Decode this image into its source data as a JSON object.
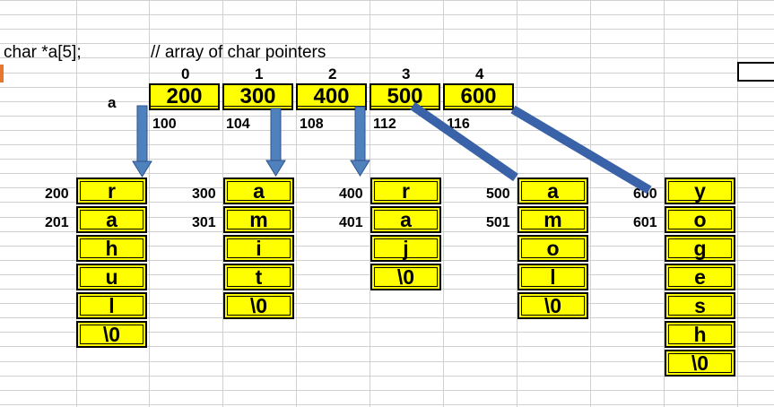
{
  "header": {
    "declaration": "char *a[5];",
    "comment": "// array of char pointers"
  },
  "array": {
    "name": "a",
    "indices": [
      "0",
      "1",
      "2",
      "3",
      "4"
    ],
    "values": [
      "200",
      "300",
      "400",
      "500",
      "600"
    ],
    "addresses": [
      "100",
      "104",
      "108",
      "112",
      "116"
    ]
  },
  "strings": [
    {
      "addresses": [
        "200",
        "201"
      ],
      "chars": [
        "r",
        "a",
        "h",
        "u",
        "l",
        "\\0"
      ]
    },
    {
      "addresses": [
        "300",
        "301"
      ],
      "chars": [
        "a",
        "m",
        "i",
        "t",
        "\\0"
      ]
    },
    {
      "addresses": [
        "400",
        "401"
      ],
      "chars": [
        "r",
        "a",
        "j",
        "\\0"
      ]
    },
    {
      "addresses": [
        "500",
        "501"
      ],
      "chars": [
        "a",
        "m",
        "o",
        "l",
        "\\0"
      ]
    },
    {
      "addresses": [
        "600",
        "601"
      ],
      "chars": [
        "y",
        "o",
        "g",
        "e",
        "s",
        "h",
        "\\0"
      ]
    }
  ],
  "colors": {
    "cell_fill": "#ffff00",
    "arrow": "#4472c4",
    "line": "#3a62a8",
    "grid": "#d0d0d0"
  }
}
